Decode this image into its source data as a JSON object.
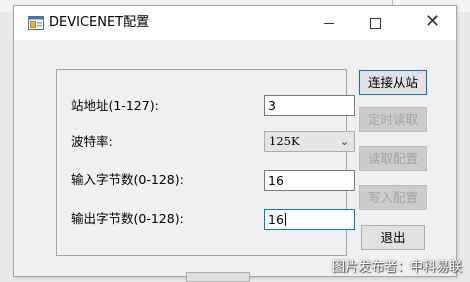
{
  "window": {
    "title": "DEVICENET配置",
    "close_glyph": "✕"
  },
  "form": {
    "station_label": "站地址(1-127):",
    "station_value": "3",
    "baud_label": "波特率:",
    "baud_value": "125K",
    "input_bytes_label": "输入字节数(0-128):",
    "input_bytes_value": "16",
    "output_bytes_label": "输出字节数(0-128):",
    "output_bytes_value": "16"
  },
  "buttons": {
    "connect": "连接从站",
    "timed_read": "定时读取",
    "read_config": "读取配置",
    "write_config": "写入配置",
    "exit": "退出"
  },
  "watermark": "图片发布者：中科易联"
}
